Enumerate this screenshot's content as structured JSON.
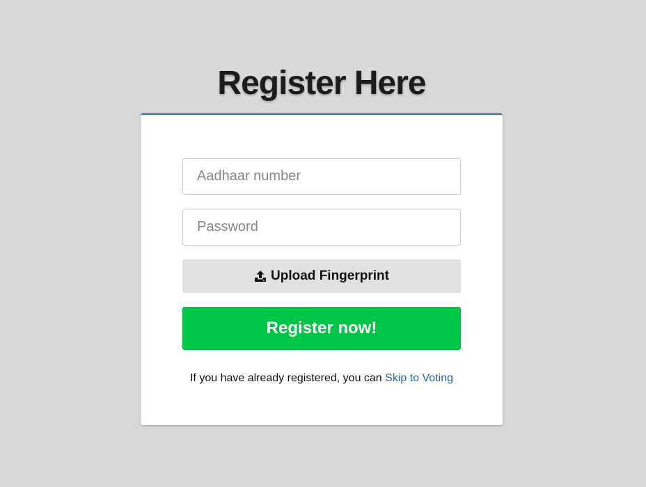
{
  "page": {
    "title": "Register Here"
  },
  "form": {
    "aadhaar": {
      "placeholder": "Aadhaar number",
      "value": ""
    },
    "password": {
      "placeholder": "Password",
      "value": ""
    },
    "upload_button_label": "Upload Fingerprint",
    "upload_icon": "upload-icon",
    "register_button_label": "Register now!"
  },
  "footer": {
    "text": "If you have already registered, you can ",
    "link_label": "Skip to Voting"
  },
  "colors": {
    "background": "#d9d9d9",
    "card_top_border": "#2a6ebb",
    "register_button": "#00c648",
    "upload_button": "#e0e1e3",
    "link": "#1f63b4"
  }
}
